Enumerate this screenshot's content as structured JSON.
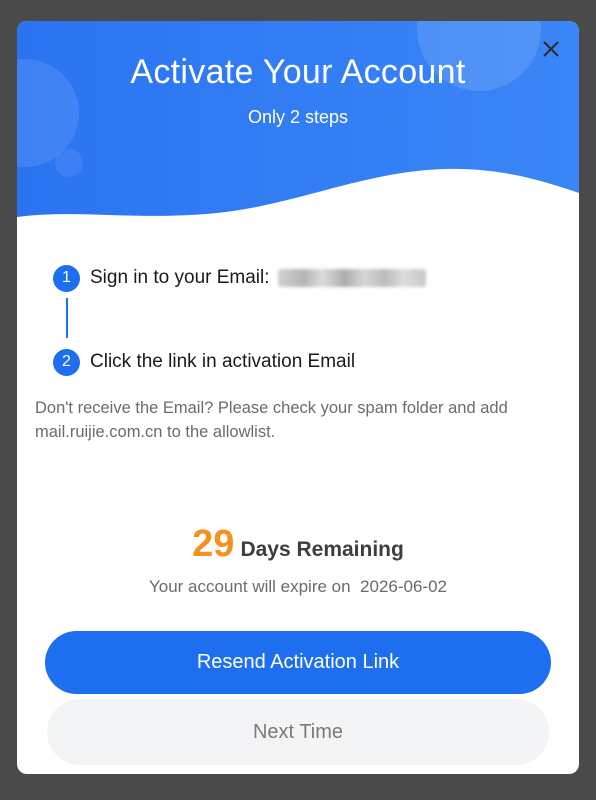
{
  "dialog": {
    "title": "Activate Your Account",
    "subtitle": "Only 2 steps",
    "close_icon": "close-icon"
  },
  "steps": [
    {
      "number": "1",
      "text": "Sign in to your Email:",
      "email_redacted": true
    },
    {
      "number": "2",
      "text": "Click the link in activation Email"
    }
  ],
  "note": "Don't receive the Email? Please check your spam folder and add mail.ruijie.com.cn to the allowlist.",
  "expiry": {
    "days": "29",
    "days_label": "Days Remaining",
    "expire_text": "Your account will expire on  2026-06-02"
  },
  "buttons": {
    "resend": "Resend Activation Link",
    "next_time": "Next Time"
  },
  "colors": {
    "accent": "#1e6ff0",
    "days_orange": "#f5921e",
    "backdrop": "#4a4a4a"
  }
}
